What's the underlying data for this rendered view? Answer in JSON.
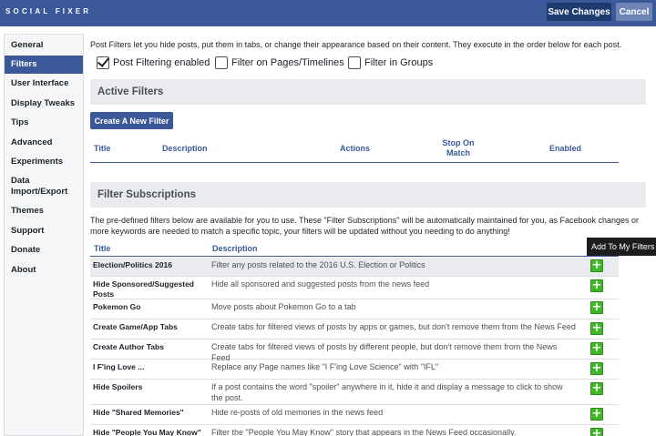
{
  "header": {
    "brand": "SOCIAL FIXER",
    "save_label": "Save Changes",
    "cancel_label": "Cancel"
  },
  "sidebar": {
    "active": "Filters",
    "items": [
      {
        "label": "General"
      },
      {
        "label": "Filters"
      },
      {
        "label": "User Interface"
      },
      {
        "label": "Display Tweaks"
      },
      {
        "label": "Tips"
      },
      {
        "label": "Advanced"
      },
      {
        "label": "Experiments"
      },
      {
        "label": "Data Import/Export"
      },
      {
        "label": "Themes"
      },
      {
        "label": "Support"
      },
      {
        "label": "Donate"
      },
      {
        "label": "About"
      }
    ]
  },
  "main": {
    "intro": "Post Filters let you hide posts, put them in tabs, or change their appearance based on their content. They execute in the order below for each post.",
    "options": [
      {
        "label": "Post Filtering enabled",
        "checked": true
      },
      {
        "label": "Filter on Pages/Timelines",
        "checked": false
      },
      {
        "label": "Filter in Groups",
        "checked": false
      }
    ],
    "active_filters": {
      "heading": "Active Filters",
      "create_label": "Create A New Filter",
      "columns": [
        "Title",
        "Description",
        "Actions",
        "Stop On Match",
        "Enabled"
      ]
    },
    "subscriptions": {
      "heading": "Filter Subscriptions",
      "intro": "The pre-defined filters below are available for you to use. These \"Filter Subscriptions\" will be automatically maintained for you, as Facebook changes or more keywords are needed to match a specific topic, your filters will be updated without you needing to do anything!",
      "columns": [
        "Title",
        "Description"
      ],
      "tooltip": "Add To My Filters",
      "add_icon": "plus-icon",
      "rows": [
        {
          "title": "Election/Politics 2016",
          "description": "Filter any posts related to the 2016 U.S. Election or Politics"
        },
        {
          "title": "Hide Sponsored/Suggested Posts",
          "description": "Hide all sponsored and suggested posts from the news feed"
        },
        {
          "title": "Pokemon Go",
          "description": "Move posts about Pokemon Go to a tab"
        },
        {
          "title": "Create Game/App Tabs",
          "description": "Create tabs for filtered views of posts by apps or games, but don't remove them from the News Feed"
        },
        {
          "title": "Create Author Tabs",
          "description": "Create tabs for filtered views of posts by different people, but don't remove them from the News Feed"
        },
        {
          "title": "I F'ing Love ...",
          "description": "Replace any Page names like \"I F'ing Love Science\" with \"IFL\""
        },
        {
          "title": "Hide Spoilers",
          "description": "If a post contains the word \"spoiler\" anywhere in it, hide it and display a message to click to show the post."
        },
        {
          "title": "Hide \"Shared Memories\"",
          "description": "Hide re-posts of old memories in the news feed"
        },
        {
          "title": "Hide \"People You May Know\"",
          "description": "Filter the \"People You May Know\" story that appears in the News Feed occasionally."
        }
      ]
    }
  },
  "colors": {
    "brand": "#3b5998",
    "add_green": "#42b72a",
    "section_bg": "#e9ebee"
  }
}
